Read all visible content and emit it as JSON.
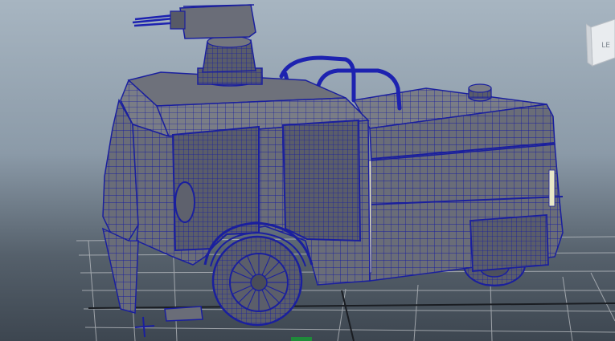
{
  "viewport": {
    "name": "perspective-viewport",
    "background_top": "#a7b5c1",
    "background_bottom": "#3d4650"
  },
  "scene": {
    "object": "fire-truck-polymesh",
    "wireframe_color": "#1a1f9e",
    "shaded_color": "#6b6e78",
    "grid_color": "#c9ccd0"
  },
  "viewcube": {
    "face_label": "LE"
  }
}
